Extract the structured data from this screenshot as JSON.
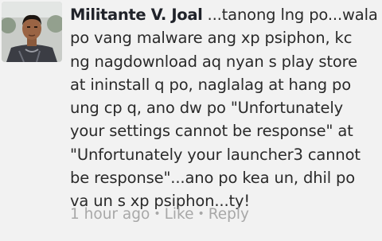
{
  "comment": {
    "author": "Militante V. Joal",
    "lines": [
      " ...tanong lng po...wala",
      "po vang malware ang xp psiphon, kc",
      "ng nagdownload aq nyan s play store",
      "at ininstall q po, naglalag at hang po",
      "ung cp q, ano dw po \"Unfortunately",
      "your settings cannot be response\" at",
      "\"Unfortunately your launcher3 cannot",
      "be response\"...ano po kea un, dhil po",
      "va un s xp psiphon...ty!"
    ],
    "timestamp": "1 hour ago",
    "separator": "•",
    "like_label": "Like",
    "reply_label": "Reply"
  },
  "colors": {
    "background": "#f2f2f2",
    "text": "#2a2a2a",
    "meta": "#a8a8a8"
  }
}
